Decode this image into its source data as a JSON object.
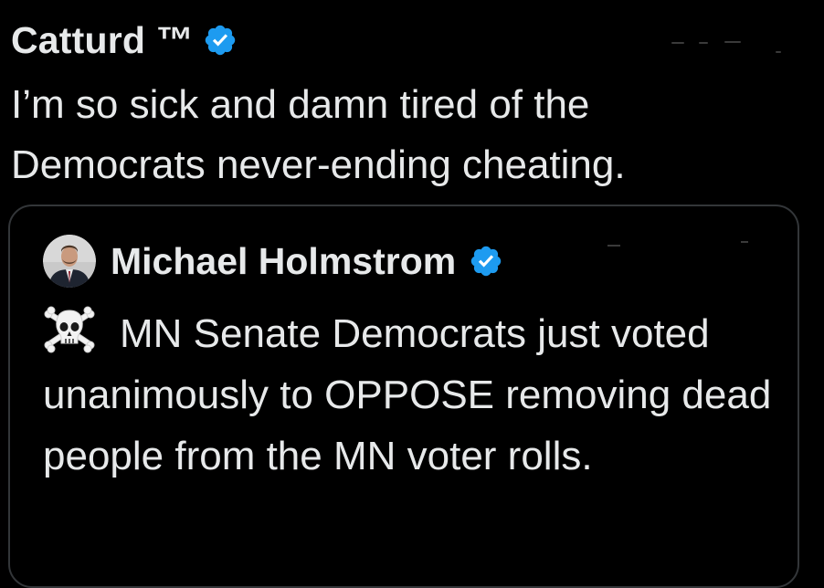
{
  "tweet": {
    "author": {
      "name": "Catturd ™",
      "verified_icon": "verified-badge-icon",
      "badge_color": "#1d9bf0"
    },
    "text": "I’m so sick and damn tired of the\nDemocrats never-ending cheating.",
    "text_color": "#e7e9ea"
  },
  "quote": {
    "author": {
      "name": "Michael Holmstrom",
      "avatar_icon": "avatar-photo-icon",
      "verified_icon": "verified-badge-icon"
    },
    "emoji_icon": "skull-and-crossbones-icon",
    "text": "MN Senate Democrats just voted unanimously to OPPOSE removing dead people from the MN voter rolls.",
    "border_color": "#333639"
  },
  "colors": {
    "background": "#000000",
    "text": "#e7e9ea",
    "verified": "#1d9bf0"
  }
}
